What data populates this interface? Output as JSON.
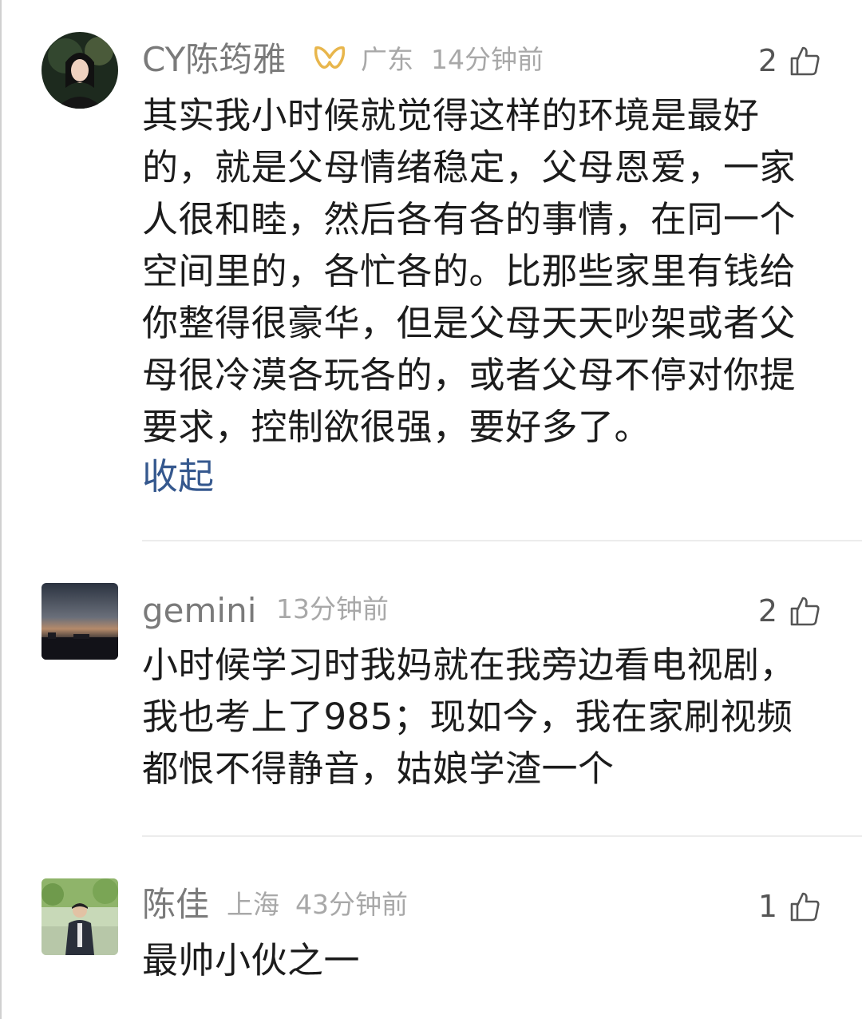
{
  "comments": [
    {
      "user": "CY陈筠雅",
      "location": "广东",
      "time": "14分钟前",
      "likes": "2",
      "text": "其实我小时候就觉得这样的环境是最好\n的，就是父母情绪稳定，父母恩爱，一家\n人很和睦，然后各有各的事情，在同一个\n空间里的，各忙各的。比那些家里有钱给\n你整得很豪华，但是父母天天吵架或者父\n母很冷漠各玩各的，或者父母不停对你提\n要求，控制欲很强，要好多了。",
      "collapse_label": "收起"
    },
    {
      "user": "gemini",
      "time": "13分钟前",
      "likes": "2",
      "text": "小时候学习时我妈就在我旁边看电视剧，\n我也考上了985；现如今，我在家刷视频\n都恨不得静音，姑娘学渣一个"
    },
    {
      "user": "陈佳",
      "location": "上海",
      "time": "43分钟前",
      "likes": "1",
      "text": "最帅小伙之一"
    }
  ],
  "colors": {
    "name": "#7a7a7a",
    "meta": "#a8a8a8",
    "link": "#35588e",
    "vip_badge": "#e8b64c"
  },
  "icons": [
    "vip-badge-icon",
    "thumbs-up-icon"
  ]
}
